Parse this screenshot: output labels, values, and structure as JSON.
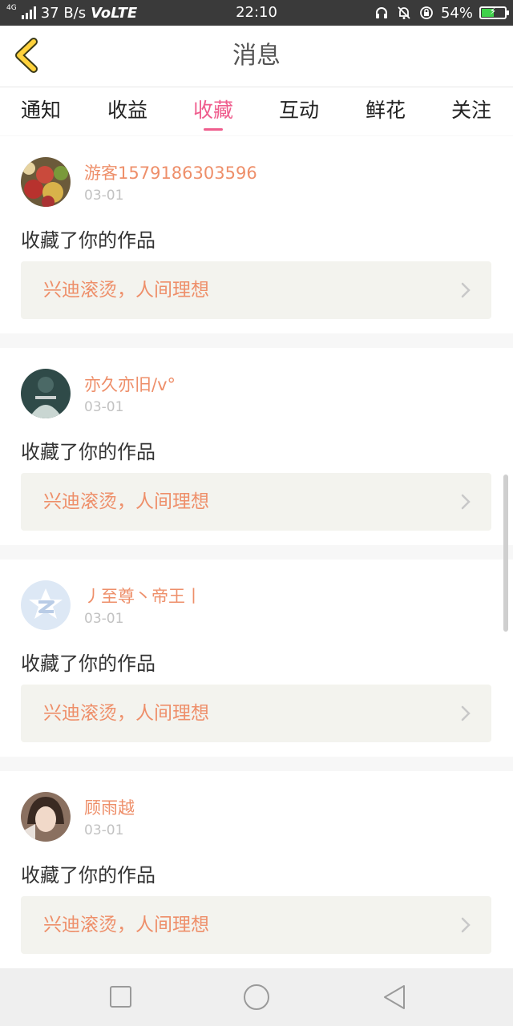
{
  "status_bar": {
    "network_type": "4G",
    "speed": "37 B/s",
    "volte": "VoLTE",
    "time": "22:10",
    "battery_percent": "54%",
    "battery_level": 0.54,
    "battery_color": "#3fd14a",
    "icons": [
      "headphones-icon",
      "mute-bell-icon",
      "rotation-lock-icon"
    ]
  },
  "header": {
    "title": "消息",
    "back_icon": "chevron-left-icon",
    "accent": "#ffd23c"
  },
  "tabs": [
    {
      "label": "通知",
      "active": false
    },
    {
      "label": "收益",
      "active": false
    },
    {
      "label": "收藏",
      "active": true
    },
    {
      "label": "互动",
      "active": false
    },
    {
      "label": "鲜花",
      "active": false
    },
    {
      "label": "关注",
      "active": false
    }
  ],
  "colors": {
    "active_tab": "#ef5d8d",
    "username": "#ee8f6a",
    "work_title": "#ee8f6a",
    "date": "#c2c2c2",
    "work_box_bg": "#f3f3ee"
  },
  "notifications": [
    {
      "user": "游客1579186303596",
      "date": "03-01",
      "action": "收藏了你的作品",
      "work_title": "兴迪滚烫，人间理想",
      "avatar": "flowers-avatar"
    },
    {
      "user": "亦久亦旧/v°",
      "date": "03-01",
      "action": "收藏了你的作品",
      "work_title": "兴迪滚烫，人间理想",
      "avatar": "dark-photo-avatar"
    },
    {
      "user": "丿至尊丶帝王丨",
      "date": "03-01",
      "action": "收藏了你的作品",
      "work_title": "兴迪滚烫，人间理想",
      "avatar": "qzone-default-avatar"
    },
    {
      "user": "顾雨越",
      "date": "03-01",
      "action": "收藏了你的作品",
      "work_title": "兴迪滚烫，人间理想",
      "avatar": "portrait-avatar"
    }
  ],
  "nav_bar": {
    "buttons": [
      "recents-square-icon",
      "home-circle-icon",
      "back-triangle-icon"
    ]
  }
}
